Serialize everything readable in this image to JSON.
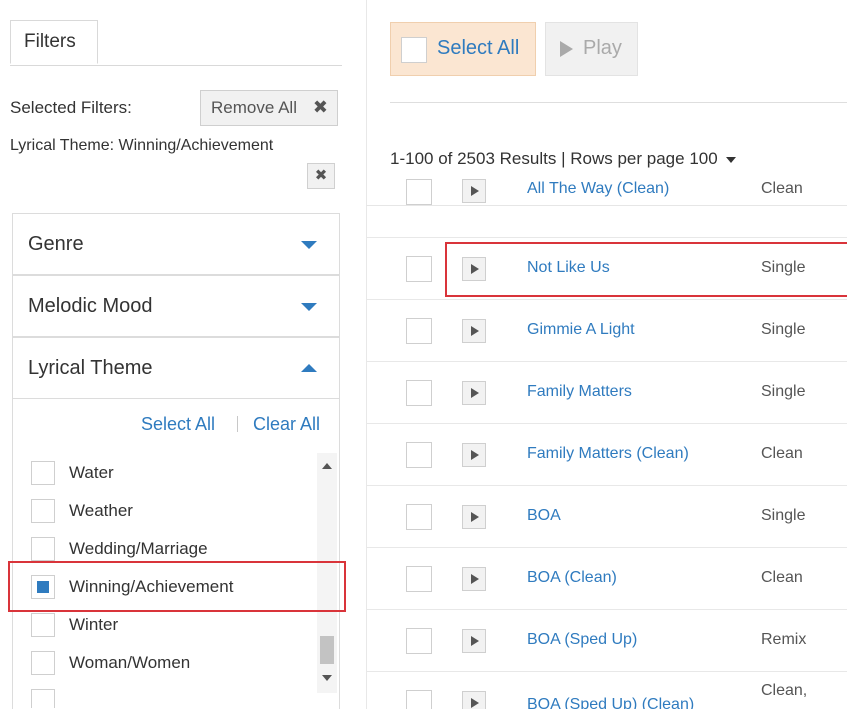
{
  "left_panel": {
    "tab_label": "Filters",
    "selected_filters_label": "Selected Filters:",
    "remove_all_label": "Remove All",
    "applied_filter": "Lyrical Theme:  Winning/Achievement",
    "facets": [
      {
        "label": "Genre",
        "state": "collapsed"
      },
      {
        "label": "Melodic Mood",
        "state": "collapsed"
      },
      {
        "label": "Lyrical Theme",
        "state": "expanded"
      }
    ],
    "select_all_label": "Select All",
    "clear_all_label": "Clear All",
    "options": [
      {
        "label": "Water",
        "checked": false
      },
      {
        "label": "Weather",
        "checked": false
      },
      {
        "label": "Wedding/Marriage",
        "checked": false
      },
      {
        "label": "Winning/Achievement",
        "checked": true
      },
      {
        "label": "Winter",
        "checked": false
      },
      {
        "label": "Woman/Women",
        "checked": false
      }
    ]
  },
  "toolbar": {
    "select_all_label": "Select All",
    "play_label": "Play"
  },
  "results": {
    "range": "1-100 of 2503 Results",
    "separator": "|",
    "rows_per_page_label": "Rows per page",
    "rows_per_page_value": "100"
  },
  "tracks": [
    {
      "title": "All The Way (Clean)",
      "type": "Clean"
    },
    {
      "title": "Not Like Us",
      "type": "Single"
    },
    {
      "title": "Gimmie A Light",
      "type": "Single"
    },
    {
      "title": "Family Matters",
      "type": "Single"
    },
    {
      "title": "Family Matters (Clean)",
      "type": "Clean"
    },
    {
      "title": "BOA",
      "type": "Single"
    },
    {
      "title": "BOA (Clean)",
      "type": "Clean"
    },
    {
      "title": "BOA (Sped Up)",
      "type": "Remix"
    },
    {
      "title": "BOA (Sped Up) (Clean)",
      "type": "Clean,"
    }
  ],
  "colors": {
    "accent_blue": "#2f7bbf",
    "highlight_red": "#d9343a",
    "select_all_bg": "#fbe6d2"
  }
}
